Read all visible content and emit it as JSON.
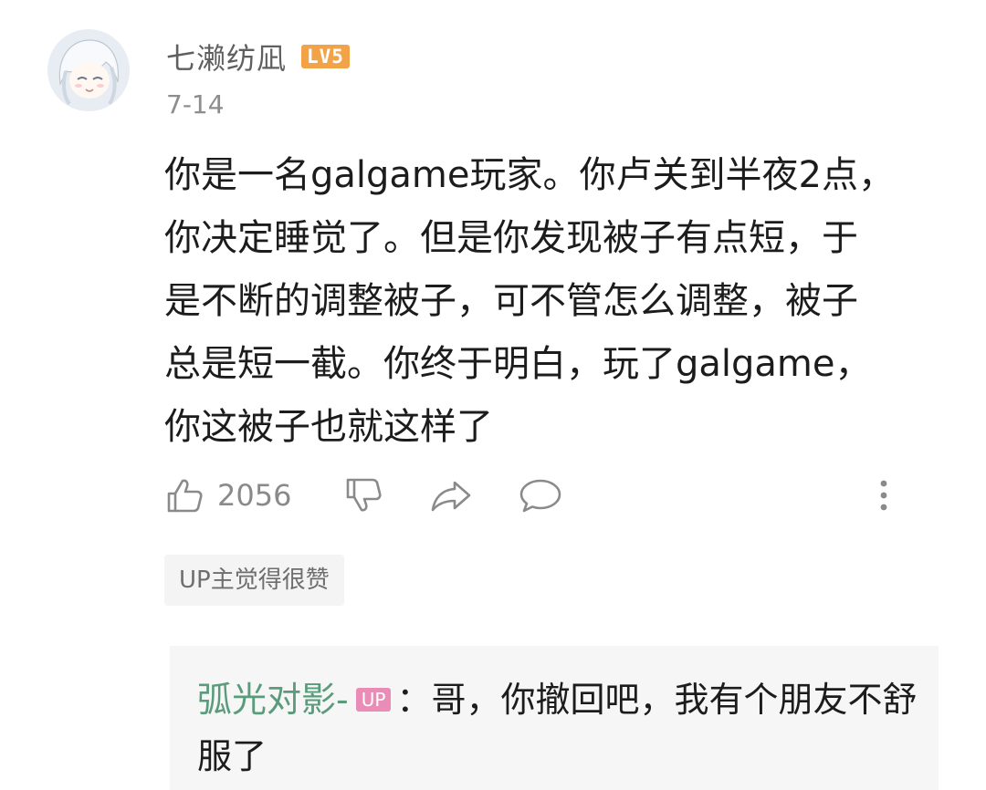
{
  "comment": {
    "username": "七濑纺凪",
    "level_badge": "LV5",
    "date": "7-14",
    "lines": [
      "你是一名galgame玩家。你卢关到半夜2点，",
      "你决定睡觉了。但是你发现被子有点短，于",
      "是不断的调整被子，可不管怎么调整，被子",
      "总是短一截。你终于明白，玩了galgame，",
      "你这被子也就这样了"
    ],
    "like_count": "2056",
    "up_liked_label": "UP主觉得很赞"
  },
  "reply": {
    "author": "弧光对影-",
    "badge": "UP",
    "separator": "：",
    "content": "哥，你撤回吧，我有个朋友不舒服了"
  },
  "icons": {
    "like": "thumbs-up-icon",
    "dislike": "thumbs-down-icon",
    "share": "share-icon",
    "reply": "comment-icon",
    "more": "more-vertical-icon"
  },
  "colors": {
    "level_badge": "#f2a247",
    "up_badge": "#e98db6",
    "reply_author": "#5a9b7c"
  }
}
